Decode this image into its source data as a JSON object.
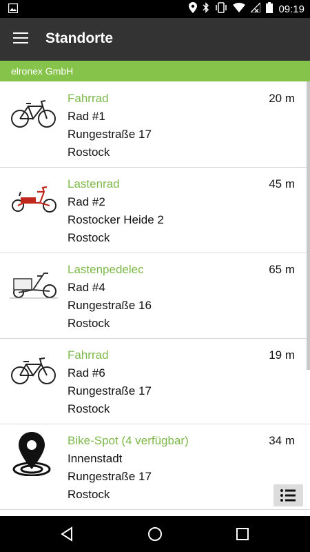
{
  "status_bar": {
    "time": "09:19"
  },
  "toolbar": {
    "title": "Standorte"
  },
  "organization": {
    "name": "elronex GmbH"
  },
  "locations": [
    {
      "category": "Fahrrad",
      "name": "Rad #1",
      "street": "Rungestraße 17",
      "city": "Rostock",
      "distance": "20 m",
      "icon": "bicycle-icon"
    },
    {
      "category": "Lastenrad",
      "name": "Rad #2",
      "street": "Rostocker Heide 2",
      "city": "Rostock",
      "distance": "45 m",
      "icon": "cargo-bike-icon"
    },
    {
      "category": "Lastenpedelec",
      "name": "Rad #4",
      "street": "Rungestraße 16",
      "city": "Rostock",
      "distance": "65 m",
      "icon": "cargo-pedelec-icon"
    },
    {
      "category": "Fahrrad",
      "name": "Rad #6",
      "street": "Rungestraße 17",
      "city": "Rostock",
      "distance": "19 m",
      "icon": "bicycle-icon"
    },
    {
      "category": "Bike-Spot (4 verfügbar)",
      "name": "Innenstadt",
      "street": "Rungestraße 17",
      "city": "Rostock",
      "distance": "34 m",
      "icon": "location-pin-icon"
    }
  ],
  "colors": {
    "accent": "#86c34a",
    "category_text": "#7db84a",
    "toolbar": "#333333",
    "cargo_frame": "#c0281e"
  }
}
